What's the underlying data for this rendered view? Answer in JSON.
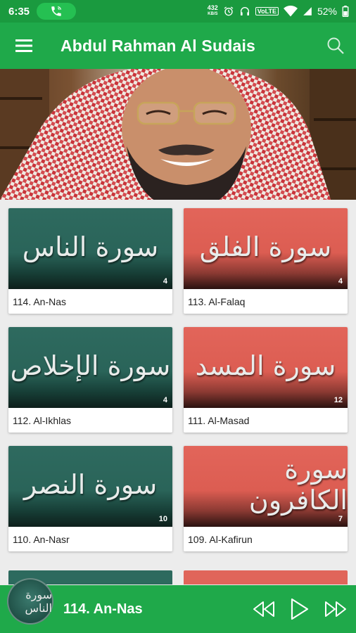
{
  "status": {
    "time": "6:35",
    "speed_value": "432",
    "speed_unit": "KB/S",
    "volte": "VoLTE",
    "battery": "52%"
  },
  "app_bar": {
    "title": "Abdul Rahman Al Sudais",
    "menu_icon": "hamburger-menu-icon",
    "search_icon": "search-icon"
  },
  "banner": {
    "image": "reciter-portrait"
  },
  "colors": {
    "primary": "#1fa94a",
    "status": "#1a9a3f",
    "teal_card": "#2e6a5f",
    "red_card": "#e2655a"
  },
  "surahs": [
    {
      "label": "114. An-Nas",
      "ayahs": "4",
      "arabic": "سورة الناس",
      "color": "teal"
    },
    {
      "label": "113. Al-Falaq",
      "ayahs": "4",
      "arabic": "سورة الفلق",
      "color": "red"
    },
    {
      "label": "112. Al-Ikhlas",
      "ayahs": "4",
      "arabic": "سورة الإخلاص",
      "color": "teal"
    },
    {
      "label": "111. Al-Masad",
      "ayahs": "12",
      "arabic": "سورة المسد",
      "color": "red"
    },
    {
      "label": "110. An-Nasr",
      "ayahs": "10",
      "arabic": "سورة النصر",
      "color": "teal"
    },
    {
      "label": "109. Al-Kafirun",
      "ayahs": "7",
      "arabic": "سورة الكافرون",
      "color": "red"
    }
  ],
  "player": {
    "now_playing": "114. An-Nas",
    "thumb_arabic": "سورة الناس",
    "controls": [
      "rewind-icon",
      "play-icon",
      "fast-forward-icon"
    ]
  }
}
